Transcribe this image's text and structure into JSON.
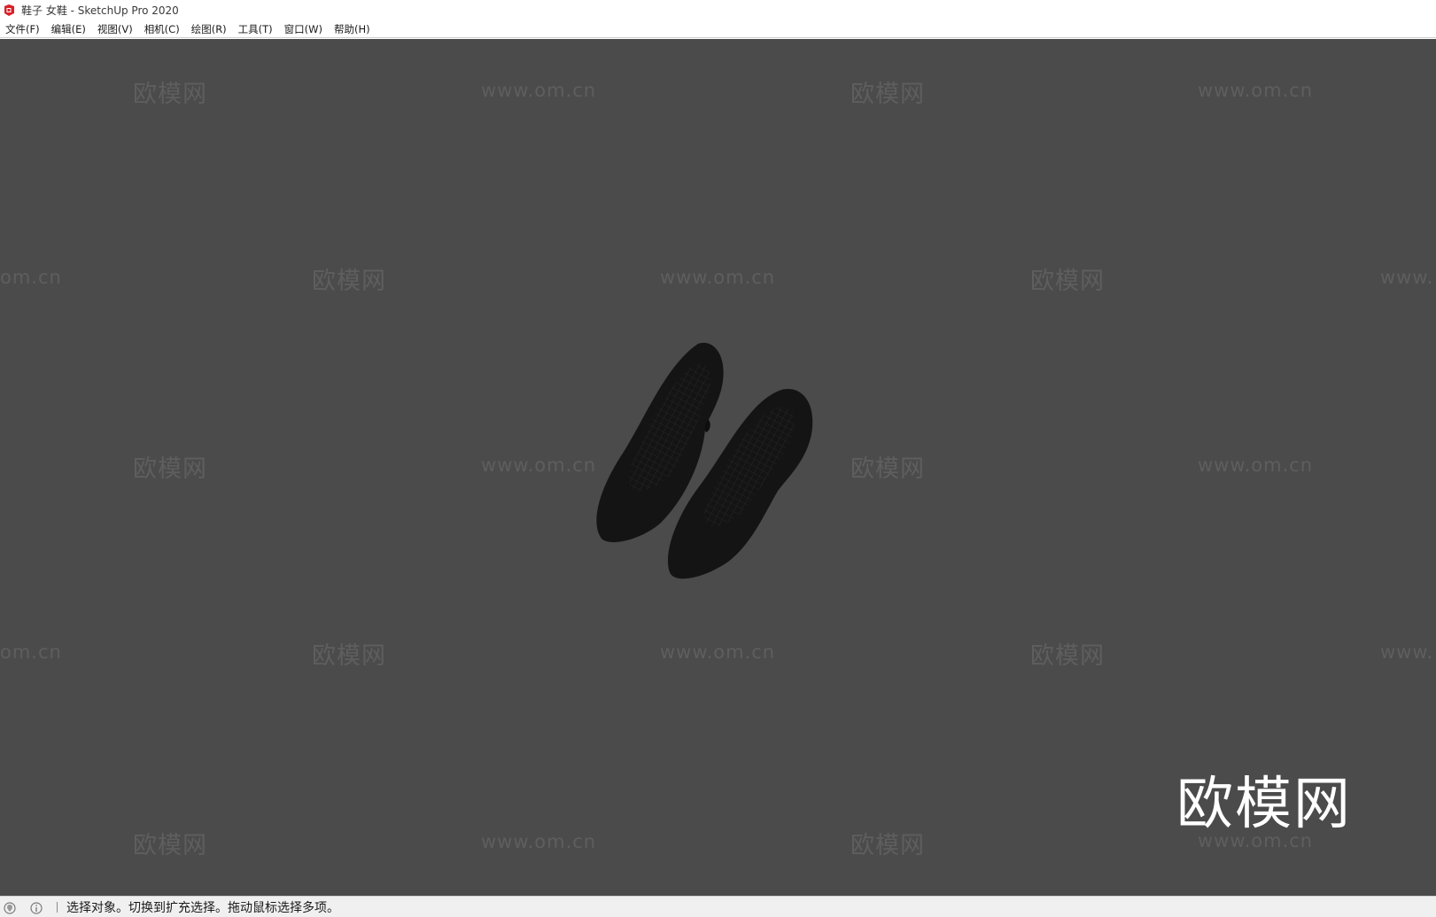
{
  "window": {
    "title": "鞋子 女鞋 - SketchUp Pro 2020"
  },
  "menu": {
    "items": [
      {
        "label": "文件(F)"
      },
      {
        "label": "编辑(E)"
      },
      {
        "label": "视图(V)"
      },
      {
        "label": "相机(C)"
      },
      {
        "label": "绘图(R)"
      },
      {
        "label": "工具(T)"
      },
      {
        "label": "窗口(W)"
      },
      {
        "label": "帮助(H)"
      }
    ]
  },
  "viewport": {
    "background_color": "#4b4b4b",
    "model_color": "#141414",
    "watermark_cn": "欧模网",
    "watermark_url": "www.om.cn",
    "watermark_url_partial_right": "www.",
    "watermark_url_partial_left": "om.cn",
    "logo_text": "欧模网",
    "logo_url": "www.om.cn"
  },
  "statusbar": {
    "icons": [
      "geolocation-icon",
      "info-icon"
    ],
    "message": "选择对象。切换到扩充选择。拖动鼠标选择多项。"
  }
}
